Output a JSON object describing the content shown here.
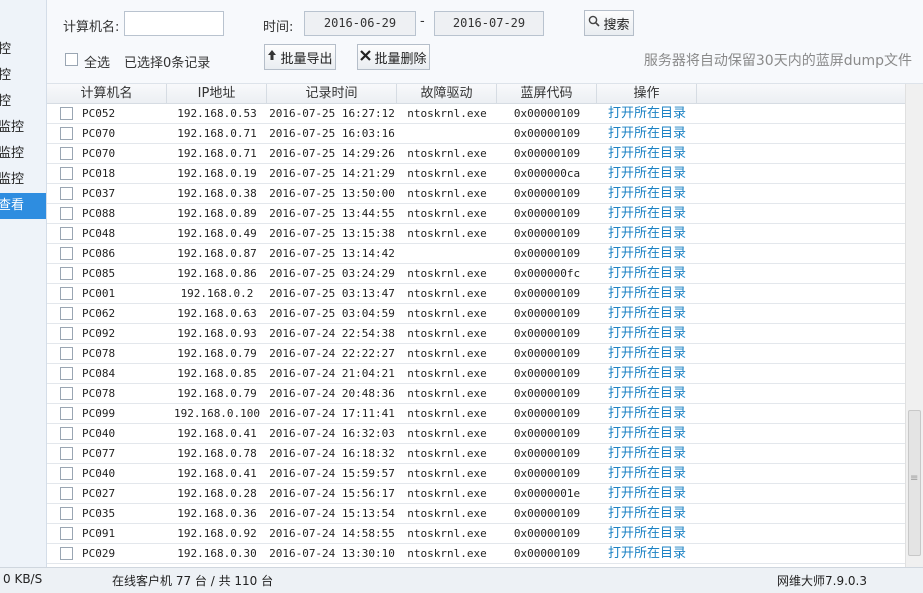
{
  "sidebar": {
    "items": [
      {
        "label": "控"
      },
      {
        "label": "控"
      },
      {
        "label": "控"
      },
      {
        "label": "监控"
      },
      {
        "label": "监控"
      },
      {
        "label": "监控"
      },
      {
        "label": "查看"
      }
    ]
  },
  "toolbar": {
    "computer_name_label": "计算机名:",
    "computer_name_value": "",
    "time_label": "时间:",
    "date_from": "2016-06-29",
    "date_sep": "-",
    "date_to": "2016-07-29",
    "search_label": "搜索",
    "select_all_label": "全选",
    "selected_text": "已选择0条记录",
    "export_label": "批量导出",
    "delete_label": "批量删除",
    "notice": "服务器将自动保留30天内的蓝屏dump文件"
  },
  "table": {
    "headers": [
      "计算机名",
      "IP地址",
      "记录时间",
      "故障驱动",
      "蓝屏代码",
      "操作"
    ],
    "action_label": "打开所在目录",
    "rows": [
      {
        "name": "PC052",
        "ip": "192.168.0.53",
        "time": "2016-07-25 16:27:12",
        "driver": "ntoskrnl.exe",
        "code": "0x00000109"
      },
      {
        "name": "PC070",
        "ip": "192.168.0.71",
        "time": "2016-07-25 16:03:16",
        "driver": "",
        "code": "0x00000109"
      },
      {
        "name": "PC070",
        "ip": "192.168.0.71",
        "time": "2016-07-25 14:29:26",
        "driver": "ntoskrnl.exe",
        "code": "0x00000109"
      },
      {
        "name": "PC018",
        "ip": "192.168.0.19",
        "time": "2016-07-25 14:21:29",
        "driver": "ntoskrnl.exe",
        "code": "0x000000ca"
      },
      {
        "name": "PC037",
        "ip": "192.168.0.38",
        "time": "2016-07-25 13:50:00",
        "driver": "ntoskrnl.exe",
        "code": "0x00000109"
      },
      {
        "name": "PC088",
        "ip": "192.168.0.89",
        "time": "2016-07-25 13:44:55",
        "driver": "ntoskrnl.exe",
        "code": "0x00000109"
      },
      {
        "name": "PC048",
        "ip": "192.168.0.49",
        "time": "2016-07-25 13:15:38",
        "driver": "ntoskrnl.exe",
        "code": "0x00000109"
      },
      {
        "name": "PC086",
        "ip": "192.168.0.87",
        "time": "2016-07-25 13:14:42",
        "driver": "",
        "code": "0x00000109"
      },
      {
        "name": "PC085",
        "ip": "192.168.0.86",
        "time": "2016-07-25 03:24:29",
        "driver": "ntoskrnl.exe",
        "code": "0x000000fc"
      },
      {
        "name": "PC001",
        "ip": "192.168.0.2",
        "time": "2016-07-25 03:13:47",
        "driver": "ntoskrnl.exe",
        "code": "0x00000109"
      },
      {
        "name": "PC062",
        "ip": "192.168.0.63",
        "time": "2016-07-25 03:04:59",
        "driver": "ntoskrnl.exe",
        "code": "0x00000109"
      },
      {
        "name": "PC092",
        "ip": "192.168.0.93",
        "time": "2016-07-24 22:54:38",
        "driver": "ntoskrnl.exe",
        "code": "0x00000109"
      },
      {
        "name": "PC078",
        "ip": "192.168.0.79",
        "time": "2016-07-24 22:22:27",
        "driver": "ntoskrnl.exe",
        "code": "0x00000109"
      },
      {
        "name": "PC084",
        "ip": "192.168.0.85",
        "time": "2016-07-24 21:04:21",
        "driver": "ntoskrnl.exe",
        "code": "0x00000109"
      },
      {
        "name": "PC078",
        "ip": "192.168.0.79",
        "time": "2016-07-24 20:48:36",
        "driver": "ntoskrnl.exe",
        "code": "0x00000109"
      },
      {
        "name": "PC099",
        "ip": "192.168.0.100",
        "time": "2016-07-24 17:11:41",
        "driver": "ntoskrnl.exe",
        "code": "0x00000109"
      },
      {
        "name": "PC040",
        "ip": "192.168.0.41",
        "time": "2016-07-24 16:32:03",
        "driver": "ntoskrnl.exe",
        "code": "0x00000109"
      },
      {
        "name": "PC077",
        "ip": "192.168.0.78",
        "time": "2016-07-24 16:18:32",
        "driver": "ntoskrnl.exe",
        "code": "0x00000109"
      },
      {
        "name": "PC040",
        "ip": "192.168.0.41",
        "time": "2016-07-24 15:59:57",
        "driver": "ntoskrnl.exe",
        "code": "0x00000109"
      },
      {
        "name": "PC027",
        "ip": "192.168.0.28",
        "time": "2016-07-24 15:56:17",
        "driver": "ntoskrnl.exe",
        "code": "0x0000001e"
      },
      {
        "name": "PC035",
        "ip": "192.168.0.36",
        "time": "2016-07-24 15:13:54",
        "driver": "ntoskrnl.exe",
        "code": "0x00000109"
      },
      {
        "name": "PC091",
        "ip": "192.168.0.92",
        "time": "2016-07-24 14:58:55",
        "driver": "ntoskrnl.exe",
        "code": "0x00000109"
      },
      {
        "name": "PC029",
        "ip": "192.168.0.30",
        "time": "2016-07-24 13:30:10",
        "driver": "ntoskrnl.exe",
        "code": "0x00000109"
      }
    ]
  },
  "statusbar": {
    "speed": "0 KB/S",
    "online_text": "在线客户机 77 台 / 共 110 台",
    "version": "网维大师7.9.0.3"
  },
  "colors": {
    "accent": "#2e8de0",
    "link": "#1b82c4"
  }
}
